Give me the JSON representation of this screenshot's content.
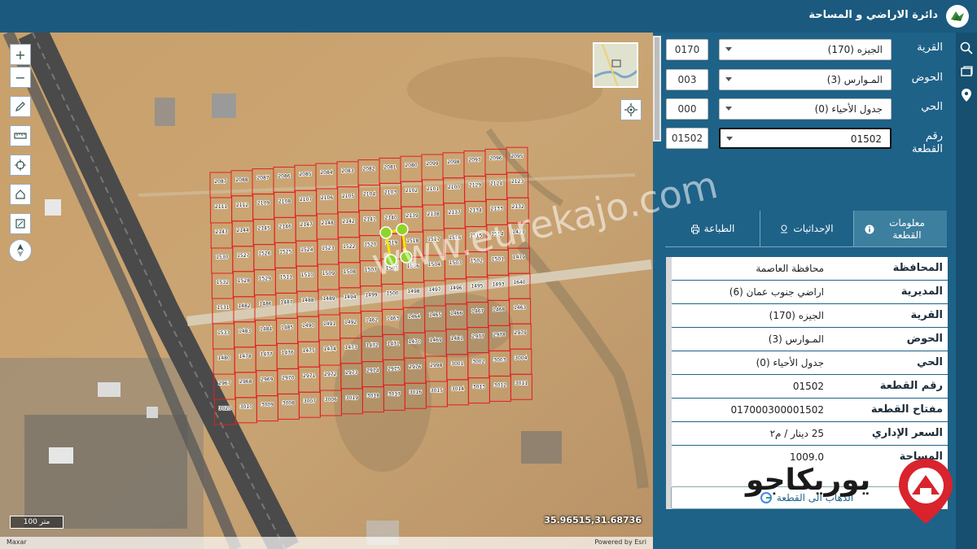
{
  "header": {
    "title": "دائرة الاراضي و المساحة"
  },
  "map": {
    "scale_label": "100 متر",
    "coordinates": "35.96515,31.68736",
    "attribution_left": "Maxar",
    "attribution_right": "Powered by Esri",
    "zoom_in": "+",
    "zoom_out": "−",
    "parcel_rows": [
      [
        "2087",
        "2088",
        "2087",
        "2086",
        "2085",
        "2084",
        "2083",
        "2082",
        "2081",
        "2080",
        "2099",
        "2098",
        "2097",
        "2096",
        "2095"
      ],
      [
        "2111",
        "2112",
        "2109",
        "2108",
        "2107",
        "2106",
        "2105",
        "2104",
        "2103",
        "2102",
        "2101",
        "2100",
        "2129",
        "2124",
        "2123"
      ],
      [
        "2143",
        "2144",
        "2145",
        "2146",
        "2147",
        "2148",
        "2142",
        "2141",
        "2140",
        "2139",
        "2138",
        "2137",
        "2134",
        "2133",
        "2132"
      ],
      [
        "1530",
        "1527",
        "1526",
        "1525",
        "1524",
        "1523",
        "1522",
        "1520",
        "1519",
        "1518",
        "1517",
        "1516",
        "1515",
        "1514",
        "1439"
      ],
      [
        "1532",
        "1528",
        "1529",
        "1511",
        "1510",
        "1509",
        "1508",
        "1507",
        "1505",
        "1506",
        "1504",
        "1503",
        "1502",
        "1501",
        "1479"
      ],
      [
        "1531",
        "1482",
        "1486",
        "1487",
        "1488",
        "1489",
        "1494",
        "1499",
        "1500",
        "1498",
        "1497",
        "1496",
        "1495",
        "1493",
        "1640"
      ],
      [
        "1533",
        "1483",
        "1484",
        "1485",
        "1490",
        "1491",
        "1492",
        "1462",
        "1463",
        "1464",
        "1465",
        "1466",
        "1467",
        "1468",
        "1463"
      ],
      [
        "1480",
        "1478",
        "1477",
        "1476",
        "1475",
        "1474",
        "1473",
        "1472",
        "1471",
        "1470",
        "1469",
        "1481",
        "2977",
        "2978",
        "2979"
      ],
      [
        "2967",
        "2968",
        "2969",
        "2970",
        "2971",
        "2972",
        "2973",
        "2974",
        "2975",
        "2976",
        "2998",
        "3001",
        "3002",
        "3003",
        "3004"
      ],
      [
        "3020",
        "3010",
        "3009",
        "3008",
        "3007",
        "3006",
        "3019",
        "3018",
        "3017",
        "3016",
        "3015",
        "3014",
        "3013",
        "3012",
        "3011"
      ]
    ]
  },
  "form": {
    "village": {
      "label": "القرية",
      "value": "الجيزه (170)",
      "code": "0170"
    },
    "basin": {
      "label": "الحوض",
      "value": "المـوارس (3)",
      "code": "003"
    },
    "district": {
      "label": "الحي",
      "value": "جدول الأحياء (0)",
      "code": "000"
    },
    "parcel": {
      "label": "رقم القطعة",
      "value": "01502",
      "code": "01502"
    }
  },
  "tabs": [
    {
      "label": "معلومات القطعة",
      "icon": "info-icon"
    },
    {
      "label": "الإحداثيات",
      "icon": "pin-icon"
    },
    {
      "label": "الطباعة",
      "icon": "print-icon"
    }
  ],
  "info": {
    "rows": [
      {
        "key": "المحافظة",
        "value": "محافظة العاصمة"
      },
      {
        "key": "المديرية",
        "value": "اراضي جنوب عمان (6)"
      },
      {
        "key": "القرية",
        "value": "الجيزه (170)"
      },
      {
        "key": "الحوض",
        "value": "المـوارس (3)"
      },
      {
        "key": "الحي",
        "value": "جدول الأحياء (0)"
      },
      {
        "key": "رقم القطعة",
        "value": "01502"
      },
      {
        "key": "مفتاح القطعة",
        "value": "017000300001502"
      },
      {
        "key": "السعر الإداري",
        "value": "25 دينار / م٢"
      },
      {
        "key": "المساحة",
        "value": "1009.0"
      }
    ],
    "goto_label": "الذهاب الى القطعة"
  },
  "watermark": {
    "text": "www.eurekajo.com",
    "logo_text": "يوريكاجو"
  },
  "colors": {
    "header": "#1b5a7e",
    "panel": "#1e6288",
    "accent_red": "#d9232d"
  }
}
